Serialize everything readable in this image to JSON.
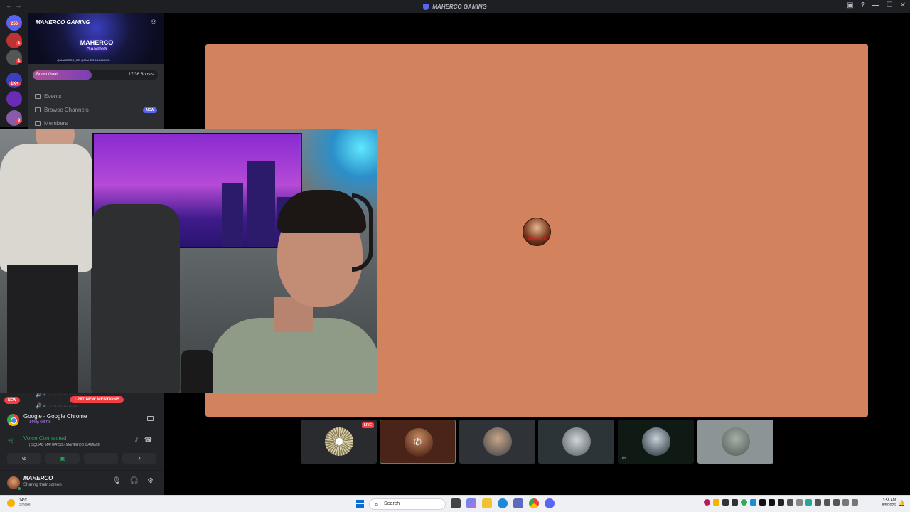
{
  "window": {
    "title": "MAHERCO GAMING"
  },
  "rail": {
    "badges": [
      "256",
      "1",
      "1",
      "1K+",
      "9"
    ]
  },
  "server": {
    "name": "MAHERCO GAMING",
    "logo_top": "MAHERCO",
    "logo_bottom": "GAMING",
    "handles": "@MAHERCO_ME  @MAHERCOGAMING",
    "boost_label": "Boost Goal",
    "boost_count": "17/36 Boosts",
    "boost_progress": 0.47
  },
  "channels": [
    {
      "label": "Events",
      "icon": "calendar-icon"
    },
    {
      "label": "Browse Channels",
      "icon": "browse-icon",
      "badge": "NEW"
    },
    {
      "label": "Members",
      "icon": "members-icon"
    }
  ],
  "lower": {
    "new_label": "NEW",
    "mentions": "1,287 NEW MENTIONS",
    "stream_title": "Google - Google Chrome",
    "stream_sub": "1440p 60FPS",
    "voice_status": "Voice Connected",
    "voice_channel": "| SQUAD MAHERCO / MAHERCO GAMING"
  },
  "user": {
    "name": "MAHERCO",
    "status": "Sharing their screen"
  },
  "tiles": [
    {
      "kind": "wheel",
      "live": "LIVE"
    },
    {
      "kind": "phone",
      "selected": true
    },
    {
      "kind": "avatar"
    },
    {
      "kind": "avatar"
    },
    {
      "kind": "avatar",
      "muted": true
    },
    {
      "kind": "avatar"
    }
  ],
  "stage": {
    "avatar_label": "MAHERCO"
  },
  "taskbar": {
    "weather_temp": "74°C",
    "weather_desc": "Smoke",
    "search": "Search",
    "time": "3:58 AM",
    "date": "8/5/2026"
  },
  "colors": {
    "stage_bg": "#d2825d",
    "accent": "#5865f2",
    "danger": "#f23f43",
    "online": "#23a55a"
  }
}
